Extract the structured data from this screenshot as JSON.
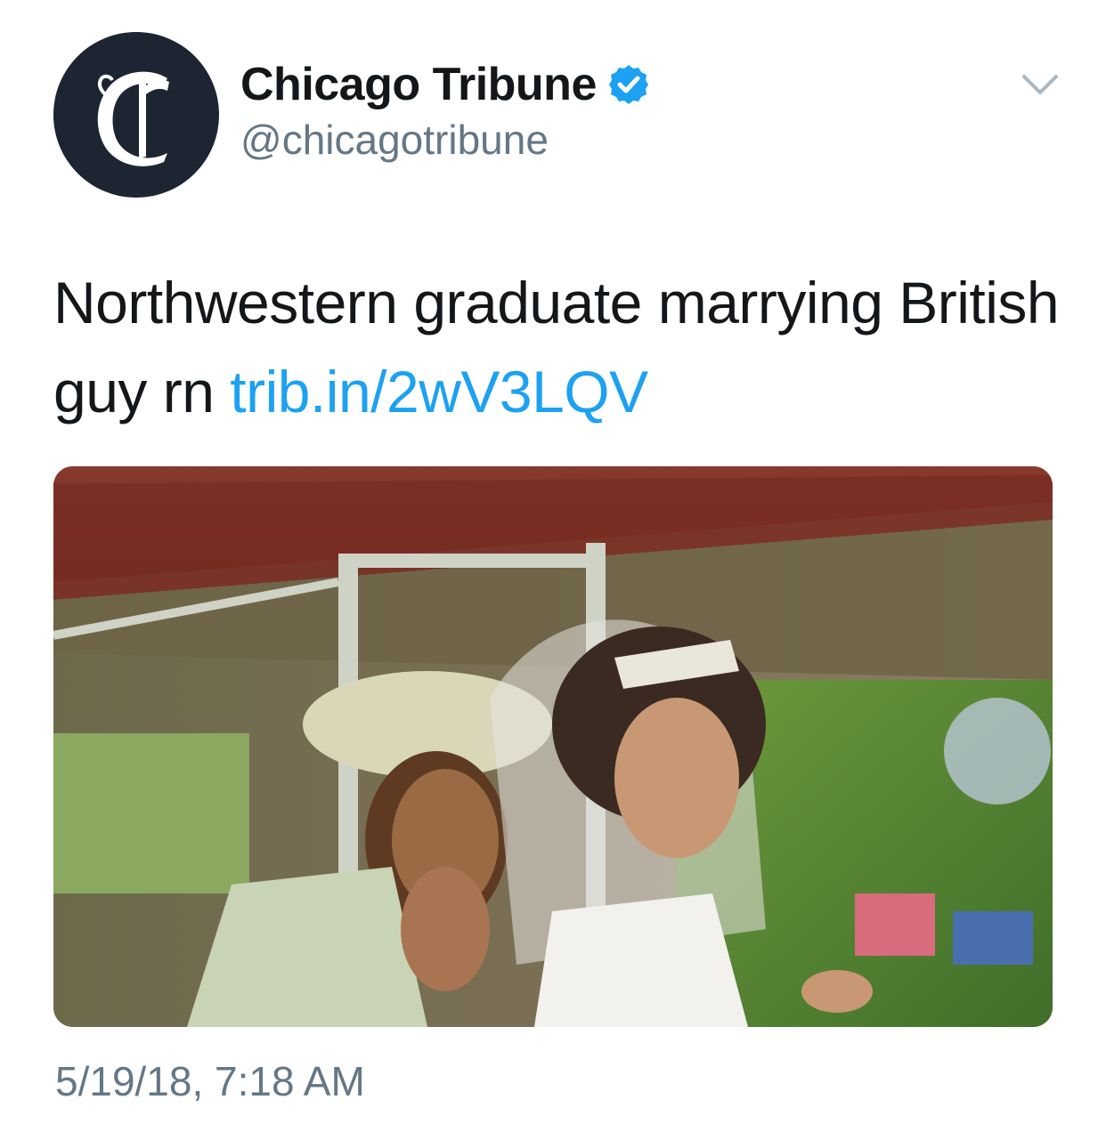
{
  "author": {
    "display_name": "Chicago Tribune",
    "handle": "@chicagotribune",
    "verified": true,
    "avatar_icon": "chicago-tribune-logo",
    "avatar_letter": "C"
  },
  "menu": {
    "icon": "chevron-down-icon"
  },
  "tweet": {
    "text": "Northwestern graduate marrying British guy rn ",
    "link_text": "trib.in/2wV3LQV"
  },
  "media": {
    "type": "photo"
  },
  "timestamp": "5/19/18, 7:18 AM",
  "colors": {
    "link": "#1da1f2",
    "verified": "#1da1f2",
    "secondary_text": "#657786",
    "primary_text": "#14171a",
    "avatar_bg": "#1d2532"
  }
}
